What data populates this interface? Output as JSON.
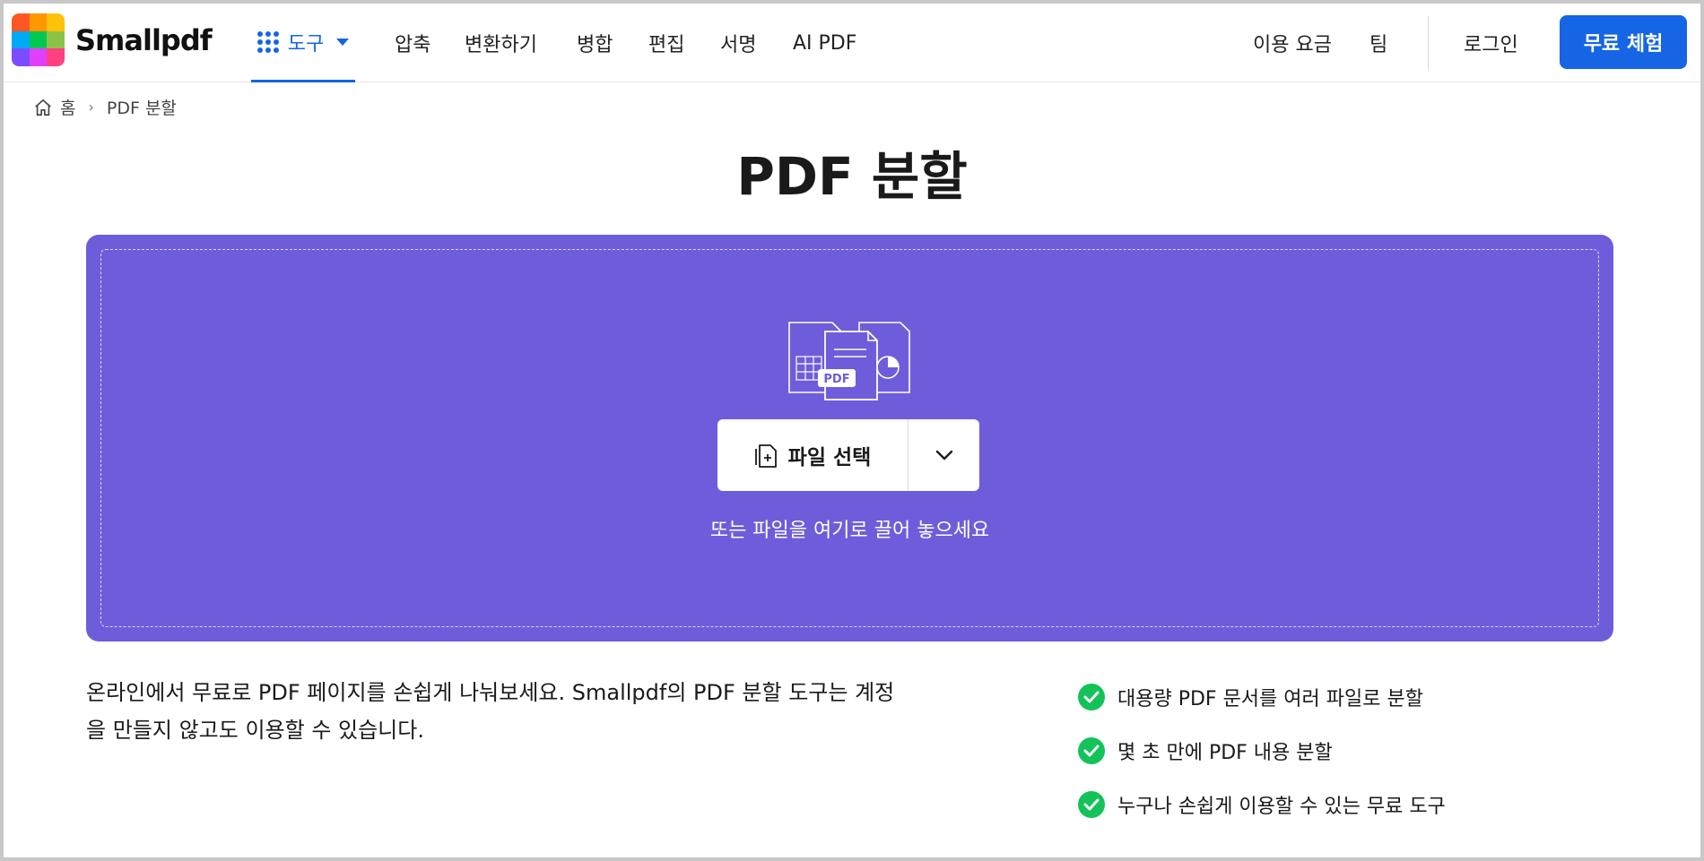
{
  "header": {
    "brand": "Smallpdf",
    "tools_label": "도구",
    "nav": [
      "압축",
      "변환하기",
      "병합",
      "편집",
      "서명",
      "AI PDF"
    ],
    "pricing": "이용 요금",
    "team": "팀",
    "login": "로그인",
    "cta": "무료 체험"
  },
  "breadcrumb": {
    "home": "홈",
    "current": "PDF 분할"
  },
  "page_title": "PDF 분할",
  "dropzone": {
    "icon_label": "PDF",
    "choose_button": "파일 선택",
    "hint": "또는 파일을 여기로 끌어 놓으세요"
  },
  "description": {
    "line1": "온라인에서 무료로 PDF 페이지를 손쉽게 나눠보세요. Smallpdf의 PDF 분할 도구는 계정",
    "line2": "을 만들지 않고도 이용할 수 있습니다."
  },
  "features": [
    "대용량 PDF 문서를 여러 파일로 분할",
    "몇 초 만에 PDF 내용 분할",
    "누구나 손쉽게 이용할 수 있는 무료 도구"
  ],
  "colors": {
    "accent": "#1565e5",
    "dropzone": "#6e5ddb",
    "check": "#14c25a"
  },
  "icons": {
    "logo": "smallpdf-logo-icon",
    "tools": "grid-dots-icon",
    "home": "home-icon",
    "file_add": "file-add-icon",
    "dropdown": "chevron-down-icon",
    "check": "check-circle-icon"
  }
}
